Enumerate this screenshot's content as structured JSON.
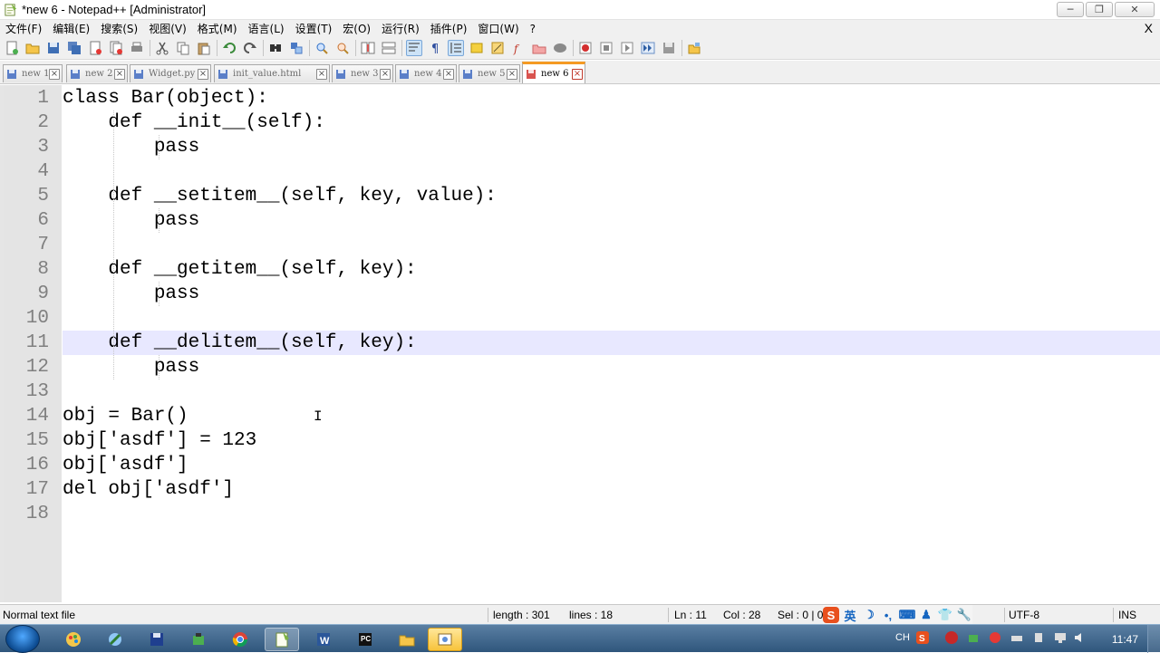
{
  "window": {
    "title": "*new 6 - Notepad++ [Administrator]",
    "controls": {
      "minimize": "─",
      "maximize": "❐",
      "close": "✕"
    }
  },
  "menu": {
    "items": [
      "文件(F)",
      "编辑(E)",
      "搜索(S)",
      "视图(V)",
      "格式(M)",
      "语言(L)",
      "设置(T)",
      "宏(O)",
      "运行(R)",
      "插件(P)",
      "窗口(W)",
      "?"
    ],
    "close_label": "X"
  },
  "toolbar": {
    "icons": [
      "new-file",
      "open-file",
      "save",
      "save-all",
      "close",
      "close-all",
      "print",
      "cut",
      "copy",
      "paste",
      "undo",
      "redo",
      "find",
      "replace",
      "zoom-in",
      "zoom-out",
      "sync-vertical",
      "sync-horizontal",
      "word-wrap",
      "show-all-chars",
      "indent-guide",
      "user-defined-lang",
      "doc-map",
      "function-list",
      "folder-workspace",
      "monitoring",
      "record-macro",
      "stop-record",
      "play-macro",
      "run-macro-multiple",
      "save-macro",
      "plugin"
    ]
  },
  "tabs": [
    {
      "label": "new 1",
      "active": false
    },
    {
      "label": "new 2",
      "active": false
    },
    {
      "label": "Widget.py",
      "active": false
    },
    {
      "label": "init_value.html",
      "active": false
    },
    {
      "label": "new 3",
      "active": false
    },
    {
      "label": "new 4",
      "active": false
    },
    {
      "label": "new 5",
      "active": false
    },
    {
      "label": "new 6",
      "active": true
    }
  ],
  "editor": {
    "current_line": 11,
    "lines": [
      "class Bar(object):",
      "    def __init__(self):",
      "        pass",
      "",
      "    def __setitem__(self, key, value):",
      "        pass",
      "",
      "    def __getitem__(self, key):",
      "        pass",
      "",
      "    def __delitem__(self, key):",
      "        pass",
      "",
      "obj = Bar()",
      "obj['asdf'] = 123",
      "obj['asdf']",
      "del obj['asdf']",
      ""
    ],
    "line_numbers": [
      "1",
      "2",
      "3",
      "4",
      "5",
      "6",
      "7",
      "8",
      "9",
      "10",
      "11",
      "12",
      "13",
      "14",
      "15",
      "16",
      "17",
      "18"
    ]
  },
  "status": {
    "file_type": "Normal text file",
    "length": "length : 301",
    "lines": "lines : 18",
    "ln": "Ln : 11",
    "col": "Col : 28",
    "sel": "Sel : 0 | 0",
    "encoding": "UTF-8",
    "mode": "INS",
    "ime": {
      "logo": "S",
      "lang": "英"
    }
  },
  "taskbar": {
    "apps": [
      "paint",
      "network",
      "save-disk",
      "tools",
      "chrome",
      "notepad-plus-plus",
      "word",
      "pycharm",
      "explorer",
      "photo-viewer"
    ],
    "tray": {
      "lang": "CH",
      "clock": "11:47"
    }
  },
  "colors": {
    "current_line_bg": "#e8e8ff",
    "gutter_bg": "#e4e4e4",
    "line_number": "#808080",
    "active_tab_accent": "#f59a23",
    "taskbar": "#3a6186"
  }
}
